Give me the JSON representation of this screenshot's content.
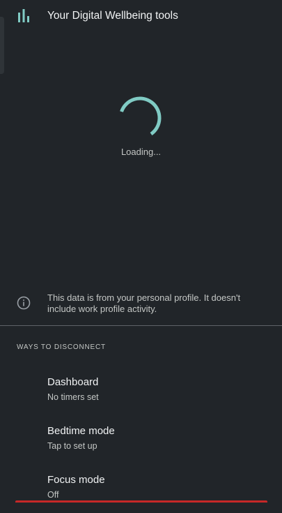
{
  "header": {
    "title": "Your Digital Wellbeing tools",
    "icon": "bar-chart-icon"
  },
  "loading": {
    "text": "Loading..."
  },
  "info": {
    "icon": "info-icon",
    "text": "This data is from your personal profile. It doesn't include work profile activity."
  },
  "disconnect": {
    "section_title": "WAYS TO DISCONNECT",
    "items": [
      {
        "title": "Dashboard",
        "subtitle": "No timers set"
      },
      {
        "title": "Bedtime mode",
        "subtitle": "Tap to set up"
      },
      {
        "title": "Focus mode",
        "subtitle": "Off"
      }
    ]
  },
  "colors": {
    "background": "#212529",
    "accent": "#80cbc4",
    "bottom_bar": "#c62828"
  }
}
